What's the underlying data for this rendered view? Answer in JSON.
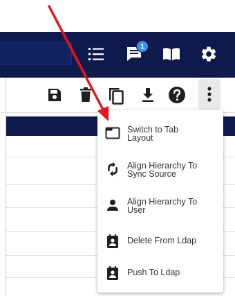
{
  "colors": {
    "header_bg": "#0e1a4c",
    "badge": "#3d8ee8",
    "icon_dark": "#1f1f1f",
    "annotation_arrow": "#e8141c"
  },
  "header": {
    "icons": [
      "list-icon",
      "notifications-icon",
      "book-icon",
      "gear-icon"
    ],
    "notification_count": "1"
  },
  "toolbar": {
    "icons": [
      "save-icon",
      "trash-icon",
      "copy-icon",
      "download-icon",
      "help-icon",
      "more-vert-icon"
    ]
  },
  "menu": {
    "items": [
      {
        "icon": "tab-layout-icon",
        "line1": "Switch to Tab",
        "line2": "Layout"
      },
      {
        "icon": "sync-icon",
        "line1": "Align Hierarchy To",
        "line2": "Sync Source"
      },
      {
        "icon": "person-icon",
        "line1": "Align Hierarchy To",
        "line2": "User"
      },
      {
        "icon": "contact-badge-icon",
        "line1": "Delete From Ldap",
        "line2": ""
      },
      {
        "icon": "contact-badge-icon",
        "line1": "Push To Ldap",
        "line2": ""
      }
    ]
  }
}
